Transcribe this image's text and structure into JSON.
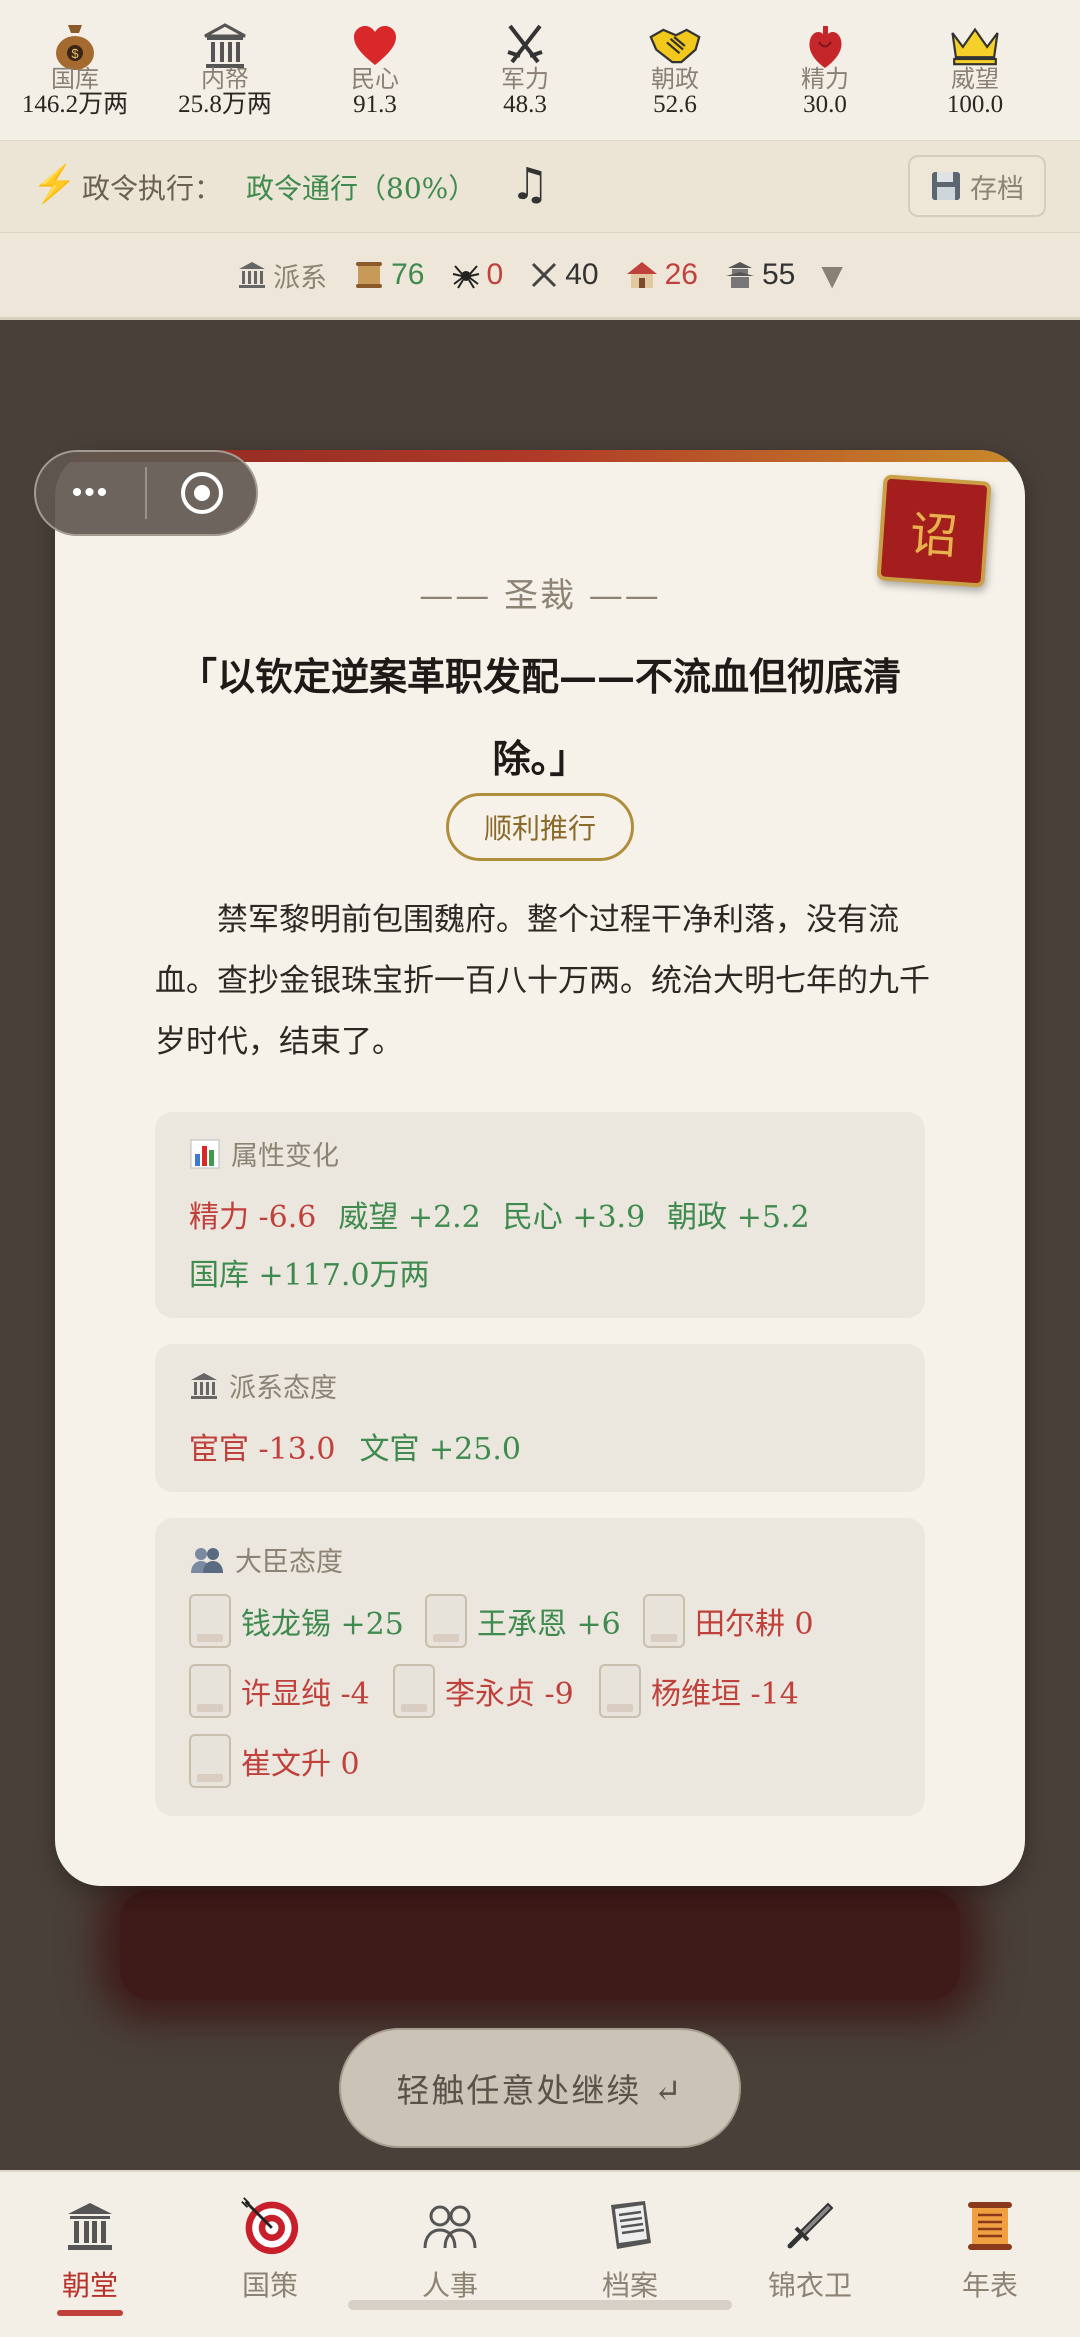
{
  "stats": [
    {
      "icon": "money-bag-icon",
      "label": "国库",
      "value": "146.2万两"
    },
    {
      "icon": "palace-icon",
      "label": "内帑",
      "value": "25.8万两"
    },
    {
      "icon": "heart-icon",
      "label": "民心",
      "value": "91.3"
    },
    {
      "icon": "crossed-swords-icon",
      "label": "军力",
      "value": "48.3"
    },
    {
      "icon": "handshake-icon",
      "label": "朝政",
      "value": "52.6"
    },
    {
      "icon": "anatomical-heart-icon",
      "label": "精力",
      "value": "30.0"
    },
    {
      "icon": "crown-icon",
      "label": "威望",
      "value": "100.0"
    }
  ],
  "exec": {
    "label": "政令执行：",
    "value": "政令通行（80%）",
    "music_icon": "music-note-icon",
    "save_label": "存档"
  },
  "factions": {
    "label": "派系",
    "items": [
      {
        "icon": "scroll-icon",
        "value": "76",
        "color": "green"
      },
      {
        "icon": "spider-icon",
        "value": "0",
        "color": "red"
      },
      {
        "icon": "crossed-swords-icon",
        "value": "40",
        "color": "dark"
      },
      {
        "icon": "house-icon",
        "value": "26",
        "color": "red"
      },
      {
        "icon": "pagoda-icon",
        "value": "55",
        "color": "dark"
      }
    ]
  },
  "card": {
    "seal": "诏",
    "title": "—— 圣裁 ——",
    "decision": "「以钦定逆案革职发配——不流血但彻底清除。」",
    "result": "顺利推行",
    "narrative": "禁军黎明前包围魏府。整个过程干净利落，没有流血。查抄金银珠宝折一百八十万两。统治大明七年的九千岁时代，结束了。",
    "attr_header": "属性变化",
    "attr_row1": [
      {
        "text": "精力 -6.6",
        "color": "red"
      },
      {
        "text": "威望 +2.2",
        "color": "green"
      },
      {
        "text": "民心 +3.9",
        "color": "green"
      },
      {
        "text": "朝政 +5.2",
        "color": "green"
      }
    ],
    "attr_row2": [
      {
        "text": "国库 +117.0万两",
        "color": "green"
      }
    ],
    "faction_header": "派系态度",
    "faction_changes": [
      {
        "text": "宦官 -13.0",
        "color": "red"
      },
      {
        "text": "文官 +25.0",
        "color": "green"
      }
    ],
    "minister_header": "大臣态度",
    "ministers": [
      {
        "text": "钱龙锡 +25",
        "color": "green"
      },
      {
        "text": "王承恩 +6",
        "color": "green"
      },
      {
        "text": "田尔耕 0",
        "color": "red"
      },
      {
        "text": "许显纯 -4",
        "color": "red"
      },
      {
        "text": "李永贞 -9",
        "color": "red"
      },
      {
        "text": "杨维垣 -14",
        "color": "red"
      },
      {
        "text": "崔文升 0",
        "color": "red"
      }
    ]
  },
  "continue_label": "轻触任意处继续 ↵",
  "nav": [
    {
      "icon": "temple-icon",
      "label": "朝堂",
      "active": true
    },
    {
      "icon": "target-icon",
      "label": "国策"
    },
    {
      "icon": "people-icon",
      "label": "人事"
    },
    {
      "icon": "archive-icon",
      "label": "档案"
    },
    {
      "icon": "dagger-icon",
      "label": "锦衣卫"
    },
    {
      "icon": "scroll-icon",
      "label": "年表"
    }
  ],
  "colors": {
    "green": "#3f8a4e",
    "red": "#c0413b",
    "accent": "#b8322b",
    "gold": "#b08f3c"
  }
}
